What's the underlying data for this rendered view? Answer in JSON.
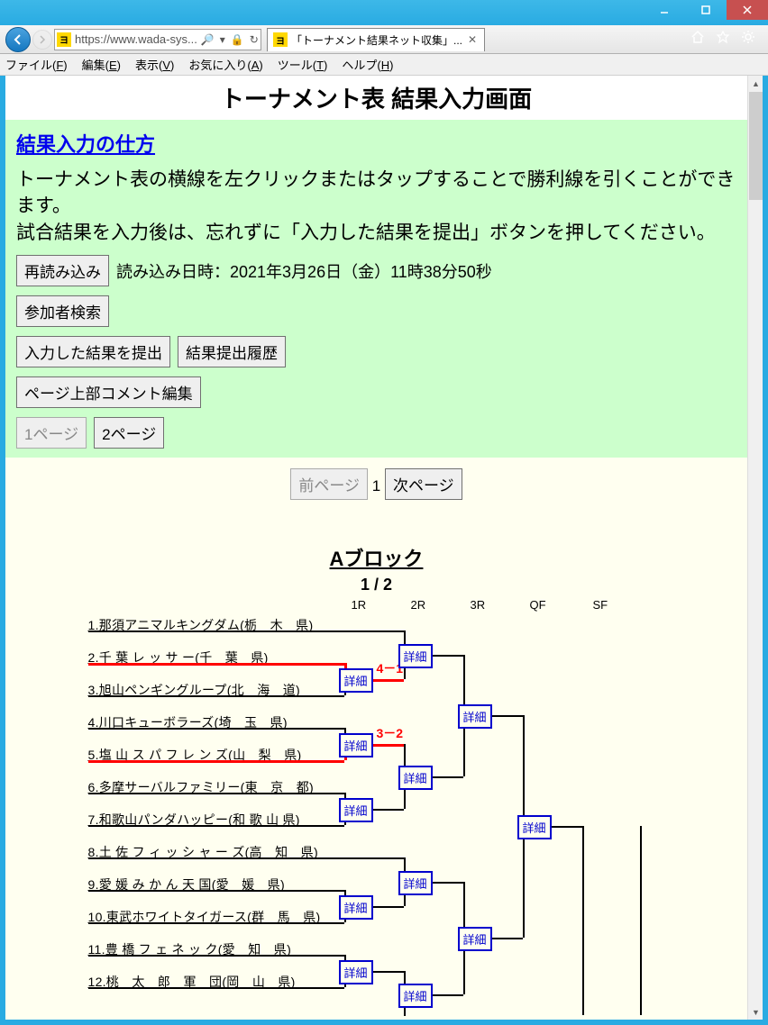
{
  "window": {
    "url": "https://www.wada-sys...",
    "search_glyph": "🔍",
    "refresh_glyph": "⟳",
    "lock_glyph": "🔒",
    "tab_title": "「トーナメント結果ネット収集」..."
  },
  "menubar": {
    "file": "ファイル(F)",
    "edit": "編集(E)",
    "view": "表示(V)",
    "favorites": "お気に入り(A)",
    "tools": "ツール(T)",
    "help": "ヘルプ(H)"
  },
  "page": {
    "title": "トーナメント表 結果入力画面",
    "howto_link": "結果入力の仕方",
    "instructions1": "トーナメント表の横線を左クリックまたはタップすることで勝利線を引くことができます。",
    "instructions2": "試合結果を入力後は、忘れずに「入力した結果を提出」ボタンを押してください。",
    "reload_btn": "再読み込み",
    "reload_ts": "読み込み日時：2021年3月26日（金）11時38分50秒",
    "search_btn": "参加者検索",
    "submit_btn": "入力した結果を提出",
    "history_btn": "結果提出履歴",
    "edit_comment_btn": "ページ上部コメント編集",
    "page1_btn": "1ページ",
    "page2_btn": "2ページ",
    "prev_btn": "前ページ",
    "page_num": "1",
    "next_btn": "次ページ",
    "block_title": "Aブロック",
    "block_sub": "1 / 2",
    "rounds": {
      "r1": "1R",
      "r2": "2R",
      "r3": "3R",
      "qf": "QF",
      "sf": "SF"
    },
    "detail_label": "詳細",
    "scores": {
      "s1": "4－1",
      "s2": "3－2"
    },
    "entries": [
      "1.那須アニマルキングダム(栃　木　県)",
      "2.千 葉 レ ッ サ ー(千　葉　県)",
      "3.旭山ペンギングループ(北　海　道)",
      "4.川口キューボラーズ(埼　玉　県)",
      "5.塩 山 ス パ フ レ ン ズ(山　梨　県)",
      "6.多摩サーバルファミリー(東　京　都)",
      "7.和歌山パンダハッピー(和 歌 山 県)",
      "8.土 佐 フ ィ ッ シ ャ ー ズ(高　知　県)",
      "9.愛 媛 み か ん 天 国(愛　媛　県)",
      "10.東武ホワイトタイガース(群　馬　県)",
      "11.豊 橋 フ ェ ネ ッ ク(愛　知　県)",
      "12.桃　太　郎　軍　団(岡　山　県)"
    ]
  }
}
